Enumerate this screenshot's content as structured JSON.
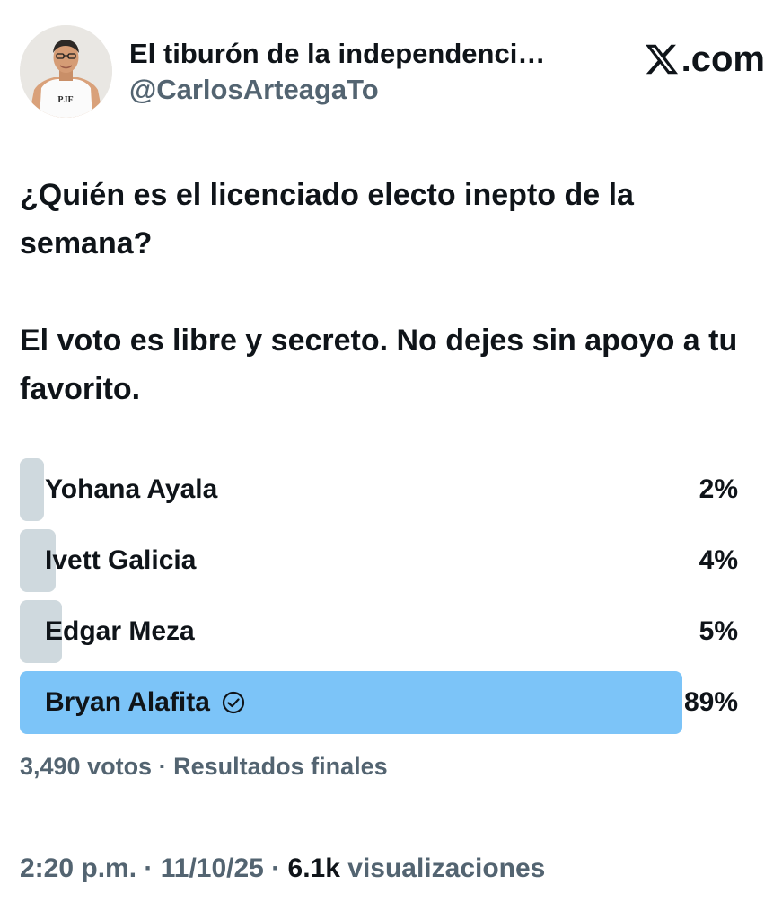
{
  "author": {
    "display_name": "El tiburón de la independenci…",
    "handle": "@CarlosArteagaTo",
    "avatar_shirt_text": "PJF"
  },
  "brand": {
    "text": ".com",
    "icon": "x-logo-icon"
  },
  "tweet": {
    "line1": "¿Quién es el licenciado electo inepto de la semana?",
    "line2": "El voto es libre y secreto. No dejes sin apoyo a tu favorito."
  },
  "poll": {
    "options": [
      {
        "label": "Yohana Ayala",
        "percent_text": "2%",
        "percent": 2,
        "winner": false
      },
      {
        "label": "Ivett Galicia",
        "percent_text": "4%",
        "percent": 4,
        "winner": false
      },
      {
        "label": "Edgar Meza",
        "percent_text": "5%",
        "percent": 5,
        "winner": false
      },
      {
        "label": "Bryan Alafita",
        "percent_text": "89%",
        "percent": 89,
        "winner": true,
        "icon": "check-circle-icon"
      }
    ],
    "summary": "3,490 votos · Resultados finales"
  },
  "meta": {
    "time": "2:20 p.m.",
    "sep1": " · ",
    "date": "11/10/25",
    "sep2": " · ",
    "views_count": "6.1k",
    "views_label": " visualizaciones"
  },
  "colors": {
    "text": "#0f1419",
    "secondary": "#536471",
    "bar": "#cfd9de",
    "winner_bar": "#7cc4f8"
  }
}
